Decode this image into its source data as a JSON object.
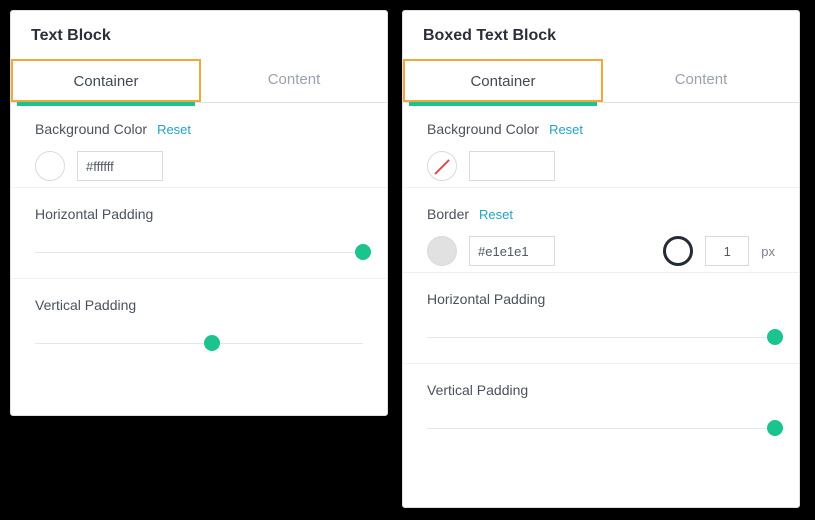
{
  "left": {
    "title": "Text Block",
    "tabs": {
      "container": "Container",
      "content": "Content"
    },
    "bg": {
      "label": "Background Color",
      "reset": "Reset",
      "value": "#ffffff"
    },
    "hpad": {
      "label": "Horizontal Padding",
      "position_pct": 100
    },
    "vpad": {
      "label": "Vertical Padding",
      "position_pct": 54
    }
  },
  "right": {
    "title": "Boxed Text Block",
    "tabs": {
      "container": "Container",
      "content": "Content"
    },
    "bg": {
      "label": "Background Color",
      "reset": "Reset",
      "value": ""
    },
    "border": {
      "label": "Border",
      "reset": "Reset",
      "color": "#e1e1e1",
      "width": "1",
      "unit": "px"
    },
    "hpad": {
      "label": "Horizontal Padding",
      "position_pct": 100
    },
    "vpad": {
      "label": "Vertical Padding",
      "position_pct": 100
    }
  }
}
